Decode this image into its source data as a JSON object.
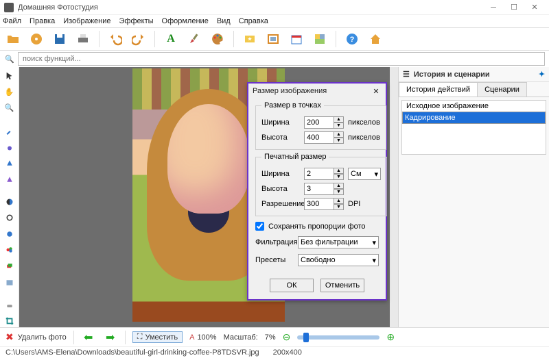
{
  "titlebar": {
    "title": "Домашняя Фотостудия"
  },
  "menu": [
    "Файл",
    "Правка",
    "Изображение",
    "Эффекты",
    "Оформление",
    "Вид",
    "Справка"
  ],
  "search": {
    "placeholder": "поиск функций..."
  },
  "rightpane": {
    "title": "История и сценарии",
    "tabs": [
      "История действий",
      "Сценарии"
    ],
    "active_tab": 0,
    "history": [
      {
        "label": "Исходное изображение",
        "selected": false
      },
      {
        "label": "Кадрирование",
        "selected": true
      }
    ]
  },
  "dialog": {
    "title": "Размер изображения",
    "pixels_group": "Размер в точках",
    "width_label": "Ширина",
    "height_label": "Высота",
    "pixels_unit": "пикселов",
    "width_px": "200",
    "height_px": "400",
    "print_group": "Печатный размер",
    "width_print": "2",
    "height_print": "3",
    "print_unit": "См",
    "res_label": "Разрешение",
    "resolution": "300",
    "res_unit": "DPI",
    "keep_ratio": "Сохранять пропорции фото",
    "filter_label": "Фильтрация",
    "filter_value": "Без фильтрации",
    "preset_label": "Пресеты",
    "preset_value": "Свободно",
    "ok": "ОК",
    "cancel": "Отменить"
  },
  "bottombar": {
    "delete": "Удалить фото",
    "fit": "Уместить",
    "hundred": "100%",
    "scale_label": "Масштаб:",
    "scale_value": "7%"
  },
  "status": {
    "path": "C:\\Users\\AMS-Elena\\Downloads\\beautiful-girl-drinking-coffee-P8TDSVR.jpg",
    "dims": "200x400"
  },
  "icons": {
    "toolbar": [
      "open-folder",
      "cd",
      "save",
      "print",
      "undo",
      "redo",
      "text",
      "palette",
      "effects-star",
      "frame",
      "calendar",
      "collage",
      "help",
      "home"
    ],
    "left": [
      "arrow-cursor",
      "hand",
      "magnifier",
      "color-picker",
      "brush-blue",
      "brush-purple",
      "triangle-blue",
      "triangle-purple",
      "half-circle",
      "adjust",
      "circle-blue",
      "palette-small",
      "layers-red",
      "image",
      "eraser",
      "crop"
    ]
  }
}
